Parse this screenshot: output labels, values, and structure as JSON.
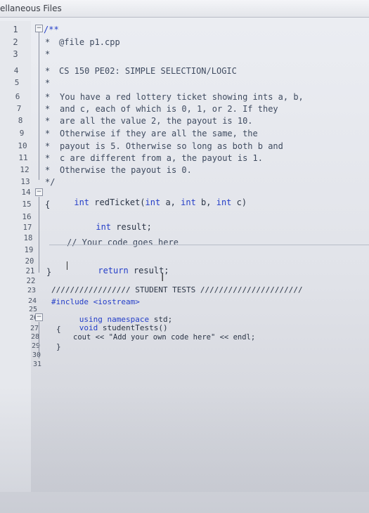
{
  "window": {
    "tab_title": "ellaneous Files"
  },
  "gutter": {
    "line_numbers": [
      "1",
      "2",
      "3",
      "4",
      "5",
      "6",
      "7",
      "8",
      "9",
      "10",
      "11",
      "12",
      "13",
      "14",
      "15",
      "16",
      "17",
      "18",
      "19",
      "20",
      "21",
      "22",
      "23",
      "24",
      "25",
      "26",
      "27",
      "28",
      "29",
      "30",
      "31"
    ]
  },
  "code": {
    "l1": "/**",
    "l2_star": "*",
    "l2": "@file p1.cpp",
    "l3": "*",
    "l4_star": "*",
    "l4": "CS 150 PE02: SIMPLE SELECTION/LOGIC",
    "l5": "*",
    "l6_star": "*",
    "l6": "You have a red lottery ticket showing ints a, b,",
    "l7_star": "*",
    "l7": "and c, each of which is 0, 1, or 2. If they",
    "l8_star": "*",
    "l8": "are all the value 2, the payout is 10.",
    "l9_star": "*",
    "l9": "Otherwise if they are all the same, the",
    "l10_star": "*",
    "l10": "payout is 5. Otherwise so long as both b and",
    "l11_star": "*",
    "l11": "c are different from a, the payout is 1.",
    "l12_star": "*",
    "l12": "Otherwise the payout is 0.",
    "l13": "*/",
    "l14_kw1": "int",
    "l14_rest": " redTicket(",
    "l14_kw2": "int",
    "l14_a": " a, ",
    "l14_kw3": "int",
    "l14_b": " b, ",
    "l14_kw4": "int",
    "l14_c": " c)",
    "l15": "{",
    "l16_kw": "int",
    "l16_rest": " result;",
    "l18": "// Your code goes here",
    "l20_kw": "return",
    "l20_rest": " result;",
    "l21": "}",
    "l23": "///////////////// STUDENT TESTS //////////////////////",
    "l24": "#include <iostream>",
    "l25_kw1": "using",
    "l25_kw2": "namespace",
    "l25_rest": " std;",
    "l26_kw": "void",
    "l26_rest": " studentTests()",
    "l27": "{",
    "l28": "cout << \"Add your own code here\" << endl;",
    "l29": "}"
  },
  "colors": {
    "keyword": "#243ec8",
    "text": "#243044",
    "line_number": "#4c5566"
  }
}
